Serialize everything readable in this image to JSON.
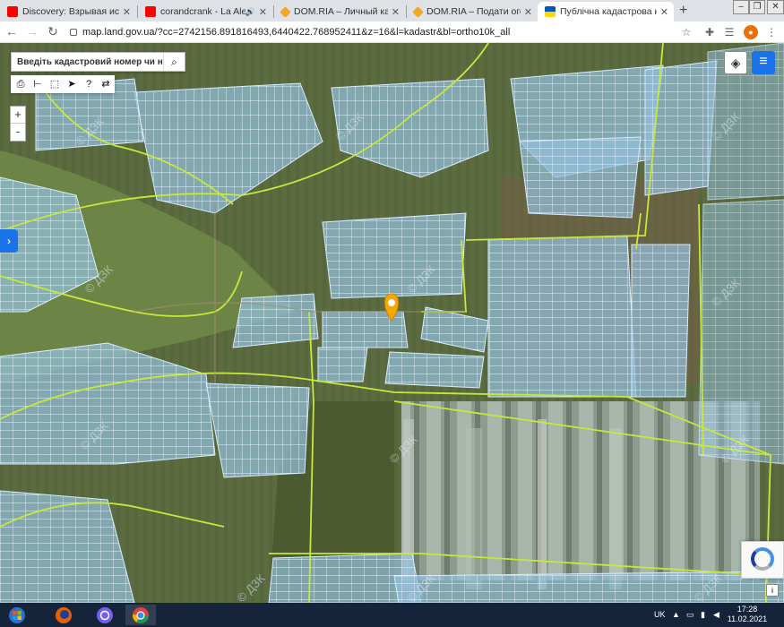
{
  "browser": {
    "tabs": [
      {
        "title": "Discovery: Взрывая историю",
        "favicon": "youtube-icon",
        "color": "#ff0000",
        "active": false
      },
      {
        "title": "corandcrank - La Alegría",
        "favicon": "youtube-icon",
        "color": "#ff0000",
        "active": false
      },
      {
        "title": "DOM.RIA – Личный кабинет",
        "favicon": "domria-icon",
        "color": "#f5a623",
        "active": false
      },
      {
        "title": "DOM.RIA – Подати оголошення",
        "favicon": "domria-icon",
        "color": "#f5a623",
        "active": false
      },
      {
        "title": "Публічна кадастрова карта",
        "favicon": "ukraine-emblem-icon",
        "color": "#0057b7",
        "active": true
      }
    ],
    "new_tab": "+",
    "address": "map.land.gov.ua/?cc=2742156.891816493,6440422.768952411&z=16&l=kadastr&bl=ortho10k_all"
  },
  "map": {
    "search": {
      "placeholder": "Введіть кадастровий номер чи населе",
      "icon": "search-icon"
    },
    "tools": [
      "printer-icon",
      "measure-distance-icon",
      "measure-area-icon",
      "pointer-icon",
      "help-icon",
      "route-icon"
    ],
    "zoom": {
      "in": "+",
      "out": "-"
    },
    "side_tab": "›",
    "watermark": "© ДЗК",
    "colors": {
      "parcel_fill": "#9ec8e4",
      "parcel_stroke": "#e6f3ff",
      "boundary": "#c7e83a",
      "marker": "#f5a800",
      "field": "#5c6f3e"
    }
  },
  "taskbar": {
    "apps": [
      "windows-start-icon",
      "firefox-icon",
      "viber-icon",
      "chrome-icon"
    ],
    "language": "UK",
    "time": "17:28",
    "date": "11.02.2021"
  }
}
